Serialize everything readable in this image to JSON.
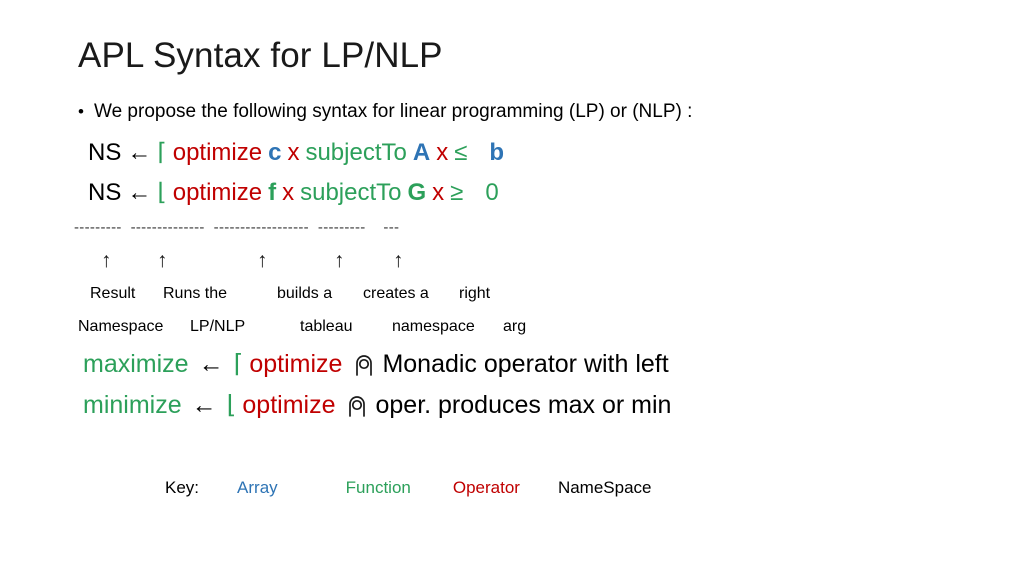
{
  "slide": {
    "title": "APL Syntax for LP/NLP",
    "background_color": "#FFFFFF"
  },
  "bullet": {
    "marker": "•",
    "text": "We propose the following syntax for linear programming (LP) or (NLP) :"
  },
  "colors": {
    "array": "#2E74B5",
    "function": "#2CA05A",
    "operator": "#C00000",
    "namespace": "#000000"
  },
  "statements": [
    {
      "namespace": "NS",
      "assign": "←",
      "operator_glyph": "⌈",
      "operator": "optimize",
      "objective": "c",
      "variable_1": "x",
      "function": "subjectTo",
      "matrix": "A",
      "variable_2": "x",
      "relation": "≤",
      "rhs": "b"
    },
    {
      "namespace": "NS",
      "assign": "←",
      "operator_glyph": "⌊",
      "operator": "optimize",
      "objective": "f",
      "variable_1": "x",
      "function": "subjectTo",
      "matrix": "G",
      "variable_2": "x",
      "relation": "≥",
      "rhs": "0"
    }
  ],
  "ruler": {
    "dashes": "---------  --------------  ------------------  ---------    ---",
    "arrow_glyph": "↑",
    "arrow_count": 5
  },
  "annotations": [
    {
      "top": "Result",
      "bottom": "Namespace"
    },
    {
      "top": "Runs the",
      "bottom": "LP/NLP"
    },
    {
      "top": "builds a",
      "bottom": "tableau"
    },
    {
      "top": "creates a",
      "bottom": "namespace"
    },
    {
      "top": "right",
      "bottom": "arg"
    }
  ],
  "definitions": [
    {
      "name": "maximize",
      "assign": "←",
      "glyph": "⌈",
      "operator": "optimize",
      "monadic_glyph": "⍥",
      "description": "Monadic operator with left"
    },
    {
      "name": "minimize",
      "assign": "←",
      "glyph": "⌊",
      "operator": "optimize",
      "monadic_glyph": "⍥",
      "description": "oper. produces max or min"
    }
  ],
  "key": {
    "label": "Key:",
    "array": "Array",
    "function": "Function",
    "operator": "Operator",
    "namespace": "NameSpace"
  }
}
